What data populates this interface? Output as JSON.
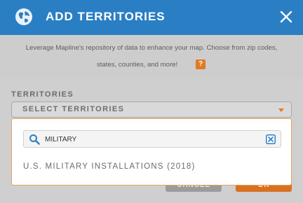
{
  "header": {
    "title": "ADD TERRITORIES",
    "color": "#2a7fc4"
  },
  "description": {
    "line1": "Leverage Mapline's repository of data to enhance your map. Choose from zip codes,",
    "line2": "states, counties, and more!",
    "help_label": "?"
  },
  "form": {
    "territories_label": "TERRITORIES",
    "select_label": "SELECT TERRITORIES"
  },
  "buttons": {
    "cancel": "CANCEL",
    "ok": "OK"
  },
  "dropdown": {
    "search_value": "MILITARY",
    "results": [
      "U.S. MILITARY INSTALLATIONS (2018)"
    ]
  },
  "colors": {
    "accent": "#e07a22",
    "brand": "#2a7fc4"
  }
}
